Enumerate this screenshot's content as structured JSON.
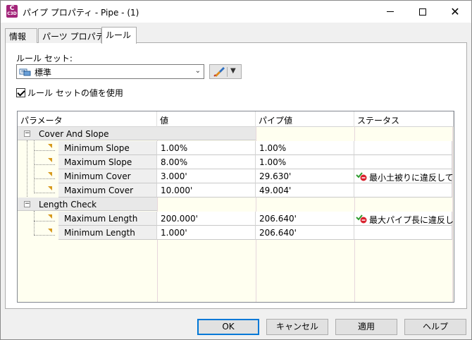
{
  "window": {
    "title": "パイプ プロパティ - Pipe - (1)",
    "app_icon_letter": "C",
    "app_icon_sub": "C3D",
    "close_glyph": "✕"
  },
  "tabs": [
    {
      "label": "情報",
      "active": false
    },
    {
      "label": "パーツ プロパティ",
      "active": false
    },
    {
      "label": "ルール",
      "active": true
    }
  ],
  "ruleset": {
    "label": "ルール セット:",
    "selected": "標準",
    "use_ruleset_values_label": "ルール セットの値を使用",
    "use_ruleset_values_checked": true,
    "icon": "ruleset-icon",
    "edit_icon": "brush-edit-icon"
  },
  "grid": {
    "columns": [
      "パラメータ",
      "値",
      "パイプ値",
      "ステータス"
    ],
    "groups": [
      {
        "name": "Cover And Slope",
        "expander": "−",
        "rows": [
          {
            "parameter": "Minimum Slope",
            "value": "1.00%",
            "pipe_value": "1.00%",
            "status": ""
          },
          {
            "parameter": "Maximum Slope",
            "value": "8.00%",
            "pipe_value": "1.00%",
            "status": ""
          },
          {
            "parameter": "Minimum Cover",
            "value": "3.000'",
            "pipe_value": "29.630'",
            "status": "最小土被りに違反して..."
          },
          {
            "parameter": "Maximum Cover",
            "value": "10.000'",
            "pipe_value": "49.004'",
            "status": ""
          }
        ]
      },
      {
        "name": "Length Check",
        "expander": "−",
        "rows": [
          {
            "parameter": "Maximum Length",
            "value": "200.000'",
            "pipe_value": "206.640'",
            "status": "最大パイプ長に違反し..."
          },
          {
            "parameter": "Minimum Length",
            "value": "1.000'",
            "pipe_value": "206.640'",
            "status": ""
          }
        ]
      }
    ],
    "colors": {
      "background": "#fffff0",
      "group_row": "#e8e8e8",
      "flag": "#d79a1d",
      "error": "#d9232e",
      "check": "#2e9b2e"
    }
  },
  "buttons": {
    "ok": "OK",
    "cancel": "キャンセル",
    "apply": "適用",
    "help": "ヘルプ"
  }
}
